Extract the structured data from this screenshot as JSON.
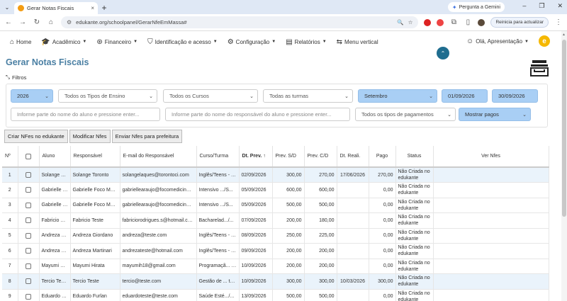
{
  "browser": {
    "tab_title": "Gerar Notas Fiscais",
    "tab_close": "×",
    "new_tab": "+",
    "gemini_label": "Pergunta a Gemini",
    "url": "edukante.org/schoolpanel/GerarNfeEmMassa#",
    "update_label": "Reinicia para actualizar",
    "menu_dots": "⋮"
  },
  "nav": {
    "home": "Home",
    "academico": "Acadêmico",
    "financeiro": "Financeiro",
    "identificacao": "Identificação e acesso",
    "configuracao": "Configuração",
    "relatorios": "Relatórios",
    "menu_vertical": "Menu vertical",
    "user": "Olá, Apresentação",
    "logo_letter": "e"
  },
  "page": {
    "title": "Gerar Notas Fiscais",
    "filtros_label": "Filtros"
  },
  "filters": {
    "year": "2026",
    "ensino": "Todos os Tipos de Ensino",
    "cursos": "Todos os Cursos",
    "turmas": "Todas as turmas",
    "month": "Setembro",
    "date_from": "01/09/2026",
    "date_to": "30/09/2026",
    "aluno_placeholder": "Informe parte do nome do aluno e pressione enter...",
    "responsavel_placeholder": "Informe parte do nome do responsável do aluno e pressione enter...",
    "pagamentos": "Todos os tipos de pagamentos",
    "mostrar": "Mostrar pagos"
  },
  "actions": {
    "criar": "Criar NFes no edukante",
    "modificar": "Modificar Nfes",
    "enviar": "Enviar Nfes para prefeitura"
  },
  "table": {
    "headers": {
      "n": "Nº",
      "aluno": "Aluno",
      "responsavel": "Responsável",
      "email": "E-mail do Responsável",
      "curso": "Curso/Turma",
      "dt_prev": "Dt. Prev.",
      "sort_icon": "↑",
      "prev_sd": "Prev. S/D",
      "prev_cd": "Prev. C/D",
      "dt_reali": "Dt. Reali.",
      "pago": "Pago",
      "status": "Status",
      "ver": "Ver Nfes"
    },
    "rows": [
      {
        "n": "1",
        "aluno": "Solange Toronto",
        "responsavel": "Solange Toronto",
        "email": "solangelaques@torontoci.com",
        "curso": "Inglês/Teens - Teens",
        "dt_prev": "02/09/2026",
        "prev_sd": "300,00",
        "prev_cd": "270,00",
        "dt_reali": "17/06/2026",
        "pago": "270,00",
        "status": "Não Criada no edukante"
      },
      {
        "n": "2",
        "aluno": "Gabrielle Foco Medicina",
        "responsavel": "Gabrielle Foco Medicina",
        "email": "gabriellearaujo@focomedicina.com",
        "curso": "Intensivo .../S...",
        "dt_prev": "05/09/2026",
        "prev_sd": "600,00",
        "prev_cd": "600,00",
        "dt_reali": "",
        "pago": "0,00",
        "status": "Não Criada no edukante"
      },
      {
        "n": "3",
        "aluno": "Gabrielle Foco Medicina",
        "responsavel": "Gabrielle Foco Medicina",
        "email": "gabriellearaujo@focomedicina.com",
        "curso": "Intensivo .../S...",
        "dt_prev": "05/09/2026",
        "prev_sd": "500,00",
        "prev_cd": "500,00",
        "dt_reali": "",
        "pago": "0,00",
        "status": "Não Criada no edukante"
      },
      {
        "n": "4",
        "aluno": "Fabricio Teste",
        "responsavel": "Fabricio Teste",
        "email": "fabriciorodrigues.s@hotmail.com",
        "curso": "Bacharelad.../...",
        "dt_prev": "07/09/2026",
        "prev_sd": "200,00",
        "prev_cd": "180,00",
        "dt_reali": "",
        "pago": "0,00",
        "status": "Não Criada no edukante"
      },
      {
        "n": "5",
        "aluno": "Andreza Giordano",
        "responsavel": "Andreza Giordano",
        "email": "andreza@teste.com",
        "curso": "Inglês/Teens - Teens",
        "dt_prev": "08/09/2026",
        "prev_sd": "250,00",
        "prev_cd": "225,00",
        "dt_reali": "",
        "pago": "0,00",
        "status": "Não Criada no edukante"
      },
      {
        "n": "6",
        "aluno": "Andreza Martinari",
        "responsavel": "Andreza Martinari",
        "email": "andrezateste@hotmail.com",
        "curso": "Inglês/Teens - Teens",
        "dt_prev": "09/09/2026",
        "prev_sd": "200,00",
        "prev_cd": "200,00",
        "dt_reali": "",
        "pago": "0,00",
        "status": "Não Criada no edukante"
      },
      {
        "n": "7",
        "aluno": "Mayumi Hirata",
        "responsavel": "Mayumi Hirata",
        "email": "mayumih18@gmail.com",
        "curso": "Programaçã... turma",
        "dt_prev": "10/09/2026",
        "prev_sd": "200,00",
        "prev_cd": "200,00",
        "dt_reali": "",
        "pago": "0,00",
        "status": "Não Criada no edukante"
      },
      {
        "n": "8",
        "aluno": "Tercio Teste",
        "responsavel": "Tercio Teste",
        "email": "tercio@teste.com",
        "curso": "Gestão de ... turma",
        "dt_prev": "10/09/2026",
        "prev_sd": "300,00",
        "prev_cd": "300,00",
        "dt_reali": "10/03/2026",
        "pago": "300,00",
        "status": "Não Criada no edukante"
      },
      {
        "n": "9",
        "aluno": "Eduardo Furlan",
        "responsavel": "Eduardo Furlan",
        "email": "eduardoteste@teste.com",
        "curso": "Saúde Esté.../...",
        "dt_prev": "13/09/2026",
        "prev_sd": "500,00",
        "prev_cd": "500,00",
        "dt_reali": "",
        "pago": "0,00",
        "status": "Não Criada no edukante"
      }
    ]
  }
}
